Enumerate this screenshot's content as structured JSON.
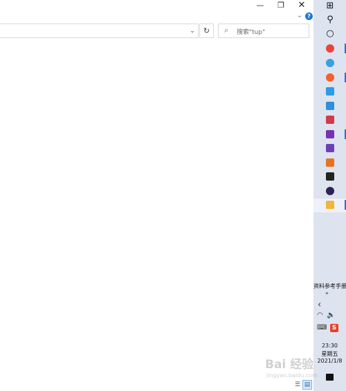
{
  "window": {
    "minimize_glyph": "—",
    "maximize_glyph": "❐",
    "close_glyph": "✕",
    "expand_ribbon_glyph": "⌄",
    "help_glyph": "?"
  },
  "addressbar": {
    "value": "",
    "dropdown_glyph": "⌄",
    "refresh_glyph": "↻"
  },
  "search": {
    "icon_glyph": "⌕",
    "placeholder": "搜索\"tup\""
  },
  "taskbar": {
    "items": [
      {
        "icon": "windows-start-icon",
        "color": "#111111",
        "active": false
      },
      {
        "icon": "search-icon",
        "color": "#111111",
        "active": false
      },
      {
        "icon": "cortana-icon",
        "color": "#111111",
        "active": false
      },
      {
        "icon": "chrome-icon",
        "color": "#e8453c",
        "active": true
      },
      {
        "icon": "ie-icon",
        "color": "#39a0e0",
        "active": false
      },
      {
        "icon": "firefox-icon",
        "color": "#f2612e",
        "active": true
      },
      {
        "icon": "media-player-icon",
        "color": "#2d9be5",
        "active": false
      },
      {
        "icon": "vpn-icon",
        "color": "#2f8fd8",
        "active": false
      },
      {
        "icon": "snipping-tool-icon",
        "color": "#d23a4a",
        "active": false
      },
      {
        "icon": "onenote-icon",
        "color": "#7a2fb0",
        "active": true
      },
      {
        "icon": "visual-studio-icon",
        "color": "#6d3fb5",
        "active": false
      },
      {
        "icon": "orange-app-icon",
        "color": "#e8731f",
        "active": false
      },
      {
        "icon": "jetbrains-icon",
        "color": "#222222",
        "active": false
      },
      {
        "icon": "eclipse-icon",
        "color": "#2c2255",
        "active": false
      },
      {
        "icon": "file-explorer-icon",
        "color": "#f0b63a",
        "active": true
      }
    ]
  },
  "tray": {
    "toolbar_label": "资料参考手册",
    "toolbar_chevron": "»",
    "show_hidden_glyph": "‹",
    "network_glyph": "◠",
    "volume_glyph": "🔈",
    "ime_glyph": "⌨",
    "sogou_glyph": "S",
    "time": "23:30",
    "day": "星期五",
    "date": "2021/1/8"
  },
  "statusbar": {
    "details_view_glyph": "☰",
    "tiles_view_glyph": "▤"
  },
  "watermark": {
    "main": "Bai 经验",
    "sub": "jingyan.baidu.com"
  }
}
